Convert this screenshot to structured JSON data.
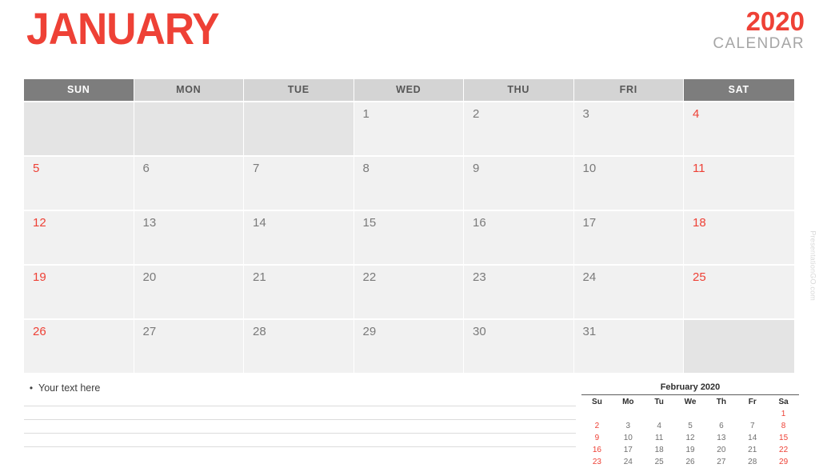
{
  "header": {
    "month": "JANUARY",
    "year": "2020",
    "subtitle": "CALENDAR"
  },
  "colors": {
    "accent_red": "#ee4136",
    "weekend_header_bg": "#7d7d7d",
    "weekday_header_bg": "#d4d4d4",
    "cell_bg": "#f1f1f1",
    "empty_cell_bg": "#e4e4e4",
    "day_text": "#7a7a7a"
  },
  "weekday_headers": [
    {
      "label": "SUN",
      "weekend": true
    },
    {
      "label": "MON",
      "weekend": false
    },
    {
      "label": "TUE",
      "weekend": false
    },
    {
      "label": "WED",
      "weekend": false
    },
    {
      "label": "THU",
      "weekend": false
    },
    {
      "label": "FRI",
      "weekend": false
    },
    {
      "label": "SAT",
      "weekend": true
    }
  ],
  "weeks": [
    [
      "",
      "",
      "",
      "1",
      "2",
      "3",
      "4"
    ],
    [
      "5",
      "6",
      "7",
      "8",
      "9",
      "10",
      "11"
    ],
    [
      "12",
      "13",
      "14",
      "15",
      "16",
      "17",
      "18"
    ],
    [
      "19",
      "20",
      "21",
      "22",
      "23",
      "24",
      "25"
    ],
    [
      "26",
      "27",
      "28",
      "29",
      "30",
      "31",
      ""
    ]
  ],
  "notes": {
    "bullet": "•",
    "text": "Your text here",
    "line_count": 4
  },
  "mini_calendar": {
    "title": "February 2020",
    "day_headers": [
      "Su",
      "Mo",
      "Tu",
      "We",
      "Th",
      "Fr",
      "Sa"
    ],
    "weeks": [
      [
        "",
        "",
        "",
        "",
        "",
        "",
        "1"
      ],
      [
        "2",
        "3",
        "4",
        "5",
        "6",
        "7",
        "8"
      ],
      [
        "9",
        "10",
        "11",
        "12",
        "13",
        "14",
        "15"
      ],
      [
        "16",
        "17",
        "18",
        "19",
        "20",
        "21",
        "22"
      ],
      [
        "23",
        "24",
        "25",
        "26",
        "27",
        "28",
        "29"
      ]
    ]
  },
  "watermark": "PresentationGO.com"
}
